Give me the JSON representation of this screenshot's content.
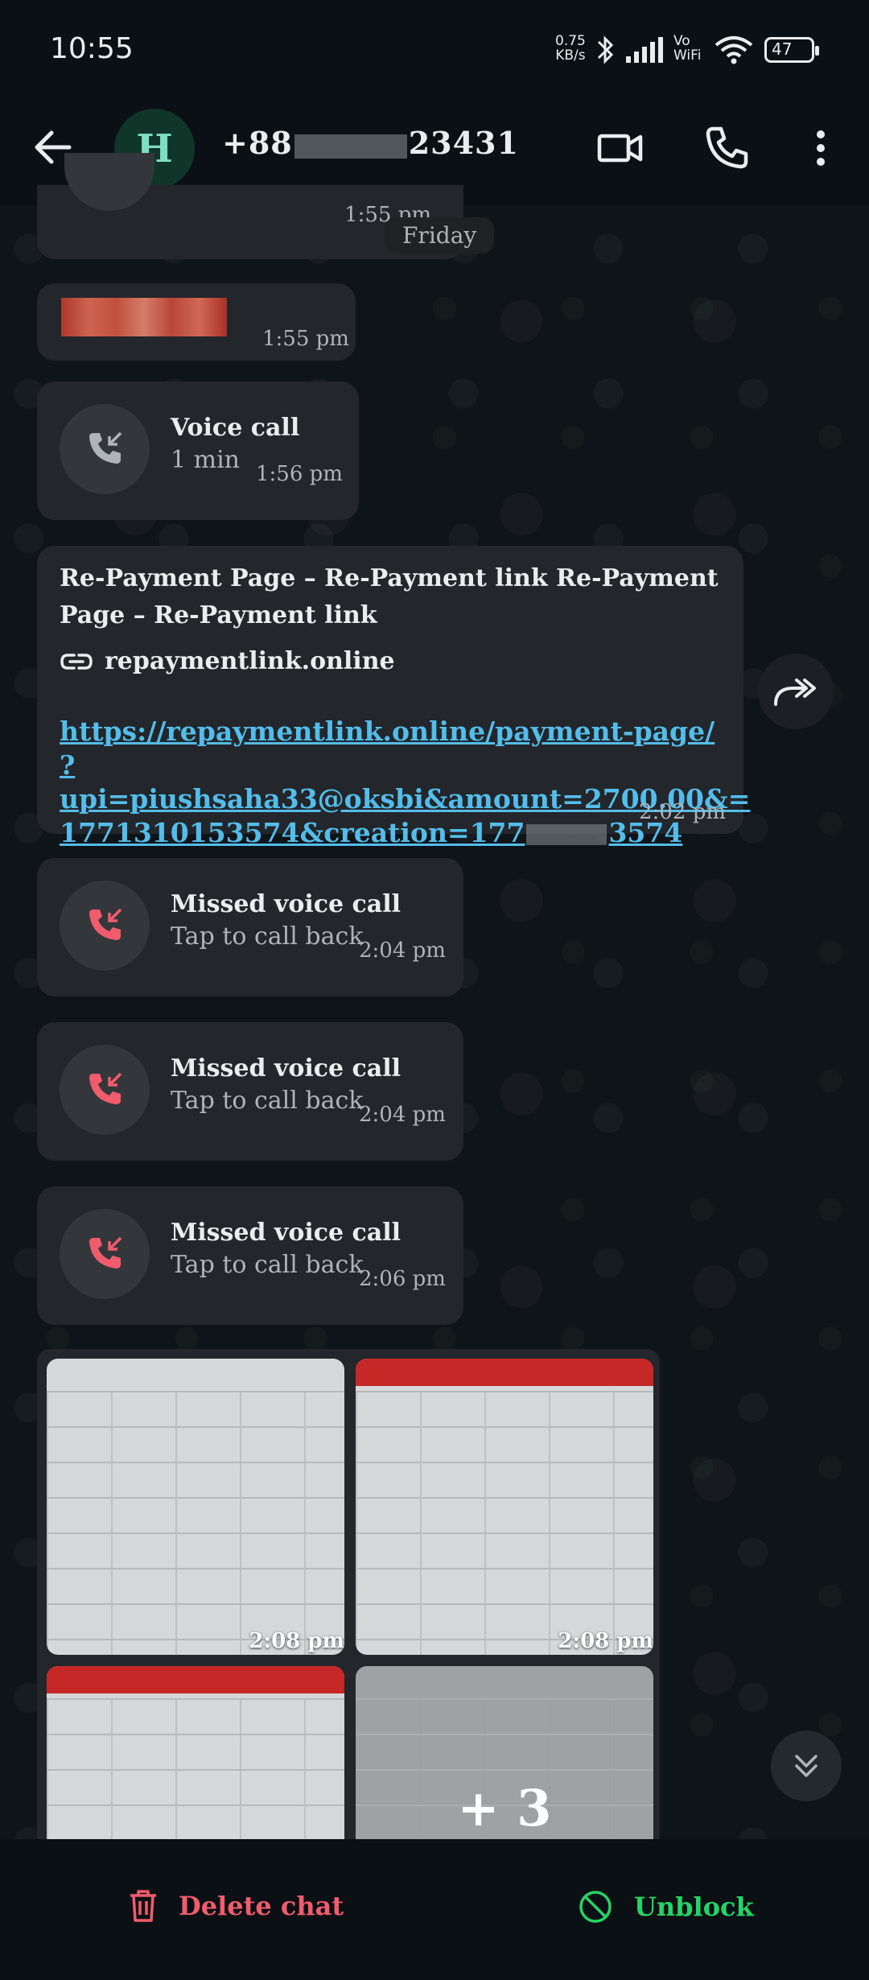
{
  "status_bar": {
    "time": "10:55",
    "net_speed_value": "0.75",
    "net_speed_unit": "KB/s",
    "vowifi_top": "Vo",
    "vowifi_bottom": "WiFi",
    "battery": "47"
  },
  "header": {
    "avatar_letter": "H",
    "contact_prefix": "+88",
    "contact_suffix": "23431",
    "icons": [
      "back-arrow-icon",
      "video-call-icon",
      "phone-icon",
      "more-vert-icon"
    ]
  },
  "chat": {
    "date_chip": "Friday",
    "partial_time": "1:55 pm",
    "redacted_message_time": "1:55 pm",
    "voice_call": {
      "title": "Voice call",
      "duration": "1 min",
      "time": "1:56 pm"
    },
    "link_message": {
      "preview_title": "Re-Payment Page – Re-Payment link      Re-Payment Page – Re-Payment link",
      "preview_domain": "repaymentlink.online",
      "url_line1": "https://repaymentlink.online/payment-page/",
      "url_line2": "?upi=piushsaha33@oksbi&amount=2700.00&=",
      "url_line3_a": "1771310153574&creation=177",
      "url_line3_b": "3574",
      "time": "2:02 pm"
    },
    "missed_calls": [
      {
        "title": "Missed voice call",
        "subtitle": "Tap to call back",
        "time": "2:04 pm"
      },
      {
        "title": "Missed voice call",
        "subtitle": "Tap to call back",
        "time": "2:04 pm"
      },
      {
        "title": "Missed voice call",
        "subtitle": "Tap to call back",
        "time": "2:06 pm"
      }
    ],
    "images": [
      {
        "time": "2:08 pm"
      },
      {
        "time": "2:08 pm"
      }
    ],
    "more_images": "+ 3"
  },
  "bottom_bar": {
    "delete_label": "Delete chat",
    "unblock_label": "Unblock"
  },
  "colors": {
    "missed_call_red": "#f15c6d",
    "delete_red": "#f15c6d",
    "unblock_green": "#25d366",
    "link_blue": "#53bdeb"
  }
}
